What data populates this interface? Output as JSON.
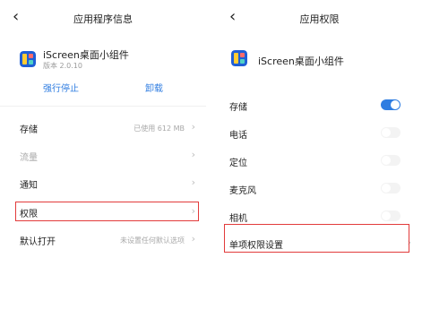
{
  "left": {
    "title": "应用程序信息",
    "app": {
      "name": "iScreen桌面小组件",
      "version": "版本 2.0.10"
    },
    "actions": {
      "force_stop": "强行停止",
      "uninstall": "卸载"
    },
    "rows": [
      {
        "label": "存储",
        "value": "已使用 612 MB"
      },
      {
        "label": "流量",
        "value": ""
      },
      {
        "label": "通知",
        "value": ""
      },
      {
        "label": "权限",
        "value": ""
      },
      {
        "label": "默认打开",
        "value": "未设置任何默认选项"
      }
    ]
  },
  "right": {
    "title": "应用权限",
    "app": {
      "name": "iScreen桌面小组件"
    },
    "permissions": [
      {
        "label": "存储",
        "enabled": true
      },
      {
        "label": "电话",
        "enabled": false
      },
      {
        "label": "定位",
        "enabled": false
      },
      {
        "label": "麦克风",
        "enabled": false
      },
      {
        "label": "相机",
        "enabled": false
      }
    ],
    "single_permission": "单项权限设置"
  },
  "colors": {
    "accent": "#2f7de1",
    "highlight": "#e23b3b"
  },
  "icons": {
    "back": "chevron-left-icon",
    "more": "chevron-right-icon",
    "app": "iscreen-app-icon"
  }
}
